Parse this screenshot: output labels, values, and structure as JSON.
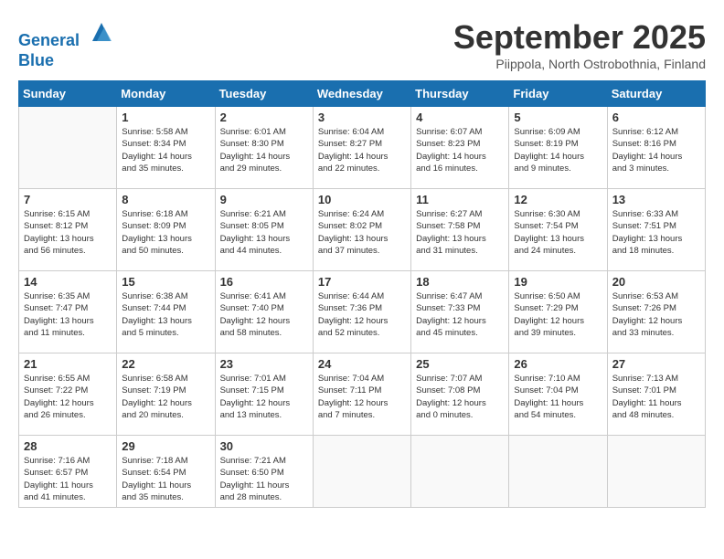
{
  "header": {
    "logo_line1": "General",
    "logo_line2": "Blue",
    "month": "September 2025",
    "location": "Piippola, North Ostrobothnia, Finland"
  },
  "weekdays": [
    "Sunday",
    "Monday",
    "Tuesday",
    "Wednesday",
    "Thursday",
    "Friday",
    "Saturday"
  ],
  "weeks": [
    [
      {
        "day": "",
        "info": ""
      },
      {
        "day": "1",
        "info": "Sunrise: 5:58 AM\nSunset: 8:34 PM\nDaylight: 14 hours\nand 35 minutes."
      },
      {
        "day": "2",
        "info": "Sunrise: 6:01 AM\nSunset: 8:30 PM\nDaylight: 14 hours\nand 29 minutes."
      },
      {
        "day": "3",
        "info": "Sunrise: 6:04 AM\nSunset: 8:27 PM\nDaylight: 14 hours\nand 22 minutes."
      },
      {
        "day": "4",
        "info": "Sunrise: 6:07 AM\nSunset: 8:23 PM\nDaylight: 14 hours\nand 16 minutes."
      },
      {
        "day": "5",
        "info": "Sunrise: 6:09 AM\nSunset: 8:19 PM\nDaylight: 14 hours\nand 9 minutes."
      },
      {
        "day": "6",
        "info": "Sunrise: 6:12 AM\nSunset: 8:16 PM\nDaylight: 14 hours\nand 3 minutes."
      }
    ],
    [
      {
        "day": "7",
        "info": "Sunrise: 6:15 AM\nSunset: 8:12 PM\nDaylight: 13 hours\nand 56 minutes."
      },
      {
        "day": "8",
        "info": "Sunrise: 6:18 AM\nSunset: 8:09 PM\nDaylight: 13 hours\nand 50 minutes."
      },
      {
        "day": "9",
        "info": "Sunrise: 6:21 AM\nSunset: 8:05 PM\nDaylight: 13 hours\nand 44 minutes."
      },
      {
        "day": "10",
        "info": "Sunrise: 6:24 AM\nSunset: 8:02 PM\nDaylight: 13 hours\nand 37 minutes."
      },
      {
        "day": "11",
        "info": "Sunrise: 6:27 AM\nSunset: 7:58 PM\nDaylight: 13 hours\nand 31 minutes."
      },
      {
        "day": "12",
        "info": "Sunrise: 6:30 AM\nSunset: 7:54 PM\nDaylight: 13 hours\nand 24 minutes."
      },
      {
        "day": "13",
        "info": "Sunrise: 6:33 AM\nSunset: 7:51 PM\nDaylight: 13 hours\nand 18 minutes."
      }
    ],
    [
      {
        "day": "14",
        "info": "Sunrise: 6:35 AM\nSunset: 7:47 PM\nDaylight: 13 hours\nand 11 minutes."
      },
      {
        "day": "15",
        "info": "Sunrise: 6:38 AM\nSunset: 7:44 PM\nDaylight: 13 hours\nand 5 minutes."
      },
      {
        "day": "16",
        "info": "Sunrise: 6:41 AM\nSunset: 7:40 PM\nDaylight: 12 hours\nand 58 minutes."
      },
      {
        "day": "17",
        "info": "Sunrise: 6:44 AM\nSunset: 7:36 PM\nDaylight: 12 hours\nand 52 minutes."
      },
      {
        "day": "18",
        "info": "Sunrise: 6:47 AM\nSunset: 7:33 PM\nDaylight: 12 hours\nand 45 minutes."
      },
      {
        "day": "19",
        "info": "Sunrise: 6:50 AM\nSunset: 7:29 PM\nDaylight: 12 hours\nand 39 minutes."
      },
      {
        "day": "20",
        "info": "Sunrise: 6:53 AM\nSunset: 7:26 PM\nDaylight: 12 hours\nand 33 minutes."
      }
    ],
    [
      {
        "day": "21",
        "info": "Sunrise: 6:55 AM\nSunset: 7:22 PM\nDaylight: 12 hours\nand 26 minutes."
      },
      {
        "day": "22",
        "info": "Sunrise: 6:58 AM\nSunset: 7:19 PM\nDaylight: 12 hours\nand 20 minutes."
      },
      {
        "day": "23",
        "info": "Sunrise: 7:01 AM\nSunset: 7:15 PM\nDaylight: 12 hours\nand 13 minutes."
      },
      {
        "day": "24",
        "info": "Sunrise: 7:04 AM\nSunset: 7:11 PM\nDaylight: 12 hours\nand 7 minutes."
      },
      {
        "day": "25",
        "info": "Sunrise: 7:07 AM\nSunset: 7:08 PM\nDaylight: 12 hours\nand 0 minutes."
      },
      {
        "day": "26",
        "info": "Sunrise: 7:10 AM\nSunset: 7:04 PM\nDaylight: 11 hours\nand 54 minutes."
      },
      {
        "day": "27",
        "info": "Sunrise: 7:13 AM\nSunset: 7:01 PM\nDaylight: 11 hours\nand 48 minutes."
      }
    ],
    [
      {
        "day": "28",
        "info": "Sunrise: 7:16 AM\nSunset: 6:57 PM\nDaylight: 11 hours\nand 41 minutes."
      },
      {
        "day": "29",
        "info": "Sunrise: 7:18 AM\nSunset: 6:54 PM\nDaylight: 11 hours\nand 35 minutes."
      },
      {
        "day": "30",
        "info": "Sunrise: 7:21 AM\nSunset: 6:50 PM\nDaylight: 11 hours\nand 28 minutes."
      },
      {
        "day": "",
        "info": ""
      },
      {
        "day": "",
        "info": ""
      },
      {
        "day": "",
        "info": ""
      },
      {
        "day": "",
        "info": ""
      }
    ]
  ]
}
